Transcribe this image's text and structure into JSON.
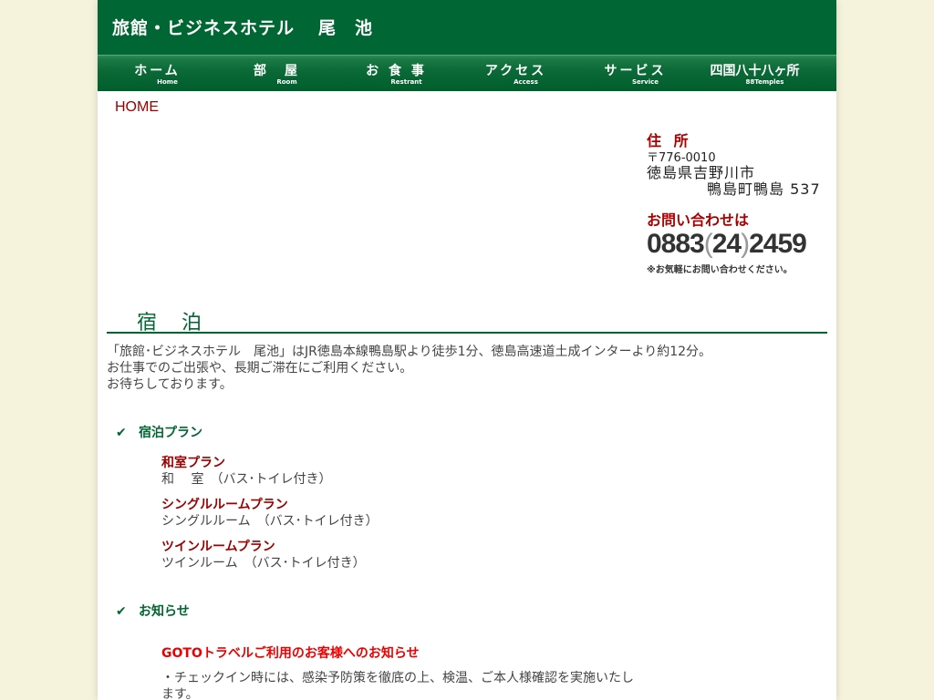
{
  "header": {
    "title_part1": "旅館・ビジネスホテル",
    "title_part2": "尾　池"
  },
  "nav": [
    {
      "jp": "ホーム",
      "en": "Home"
    },
    {
      "jp": "部　屋",
      "en": "Room"
    },
    {
      "jp": "お 食 事",
      "en": "Restrant"
    },
    {
      "jp": "アクセス",
      "en": "Access"
    },
    {
      "jp": "サービス",
      "en": "Service"
    },
    {
      "jp": "四国八十八ヶ所",
      "en": "88Temples"
    }
  ],
  "breadcrumb": "HOME",
  "address": {
    "heading": "住 所",
    "postal": "〒776-0010",
    "line1": "徳島県吉野川市",
    "line2": "鴨島町鴨島 537",
    "contact_heading": "お問い合わせは",
    "phone_area": "0883",
    "phone_paren_open": "(",
    "phone_exchange": "24",
    "phone_paren_close": ")",
    "phone_number": "2459",
    "note": "※お気軽にお問い合わせください。"
  },
  "section": {
    "title": "宿 泊",
    "intro": [
      "「旅館･ビジネスホテル　尾池」はJR徳島本線鴨島駅より徒歩1分、徳島高速道土成インターより約12分。",
      "お仕事でのご出張や、長期ご滞在にご利用ください。",
      "お待ちしております。"
    ]
  },
  "plans_heading": "宿泊プラン",
  "plans": [
    {
      "title": "和室プラン",
      "desc": "和　 室　（バス･トイレ付き）"
    },
    {
      "title": "シングルルームプラン",
      "desc": "シングルルーム　（バス･トイレ付き）"
    },
    {
      "title": "ツインルームプラン",
      "desc": "ツインルーム　（バス･トイレ付き）"
    }
  ],
  "news_heading": "お知らせ",
  "news": {
    "title": "GOTOトラベルご利用のお客様へのお知らせ",
    "body": "・チェックイン時には、感染予防策を徹底の上、検温、ご本人様確認を実施いたします。"
  },
  "icons": {
    "check": "check-icon"
  },
  "colors": {
    "brand_green": "#006633",
    "accent_red": "#aa0000",
    "page_bg": "#f5f3dc"
  }
}
